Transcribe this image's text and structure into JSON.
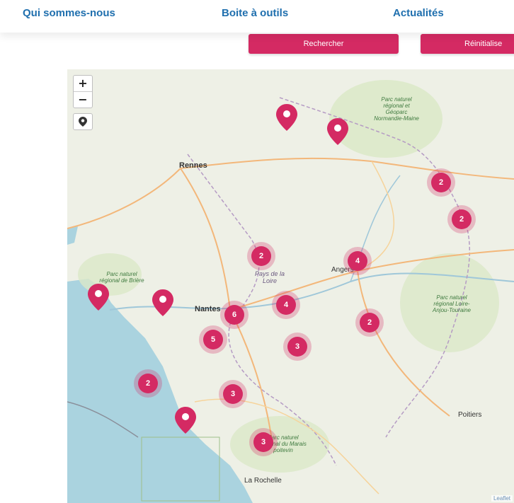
{
  "nav": {
    "links": [
      "Qui sommes-nous",
      "Boite à outils",
      "Actualités"
    ]
  },
  "buttons": {
    "search": "Rechercher",
    "reset": "Réinitialise"
  },
  "map": {
    "zoom_in": "+",
    "zoom_out": "−",
    "attribution": "Leaflet",
    "marker_color": "#d42a63",
    "places": [
      {
        "name": "Rennes"
      },
      {
        "name": "Nantes"
      },
      {
        "name": "Angers"
      },
      {
        "name": "Poitiers"
      },
      {
        "name": "La Rochelle"
      },
      {
        "name": "Pays de la Loire"
      }
    ],
    "parks": [
      "Parc naturel régional et Géoparc Normandie-Maine",
      "Parc naturel régional de Brière",
      "Parc naturel régional Loire-Anjou-Touraine",
      "Parc naturel régional du Marais poitevin"
    ],
    "clusters": [
      "2",
      "2",
      "2",
      "4",
      "4",
      "6",
      "5",
      "2",
      "3",
      "2",
      "3",
      "3"
    ],
    "pin_count": 5
  }
}
